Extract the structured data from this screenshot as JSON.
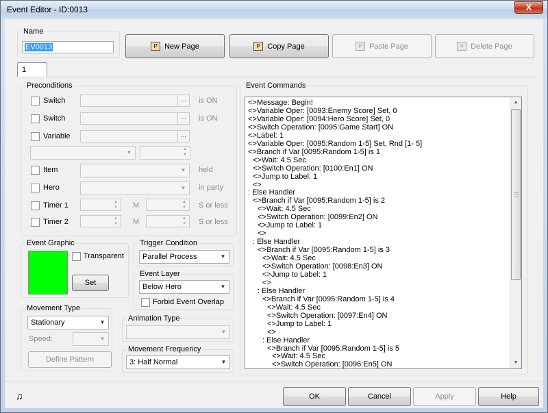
{
  "window": {
    "title": "Event Editor - ID:0013",
    "close_glyph": "X"
  },
  "name_group": {
    "legend": "Name",
    "value": "EV0013"
  },
  "toolbar": {
    "new_page": "New Page",
    "copy_page": "Copy Page",
    "paste_page": "Paste Page",
    "delete_page": "Delete Page"
  },
  "tabs": [
    {
      "label": "1"
    }
  ],
  "preconditions": {
    "legend": "Preconditions",
    "switch1": {
      "label": "Switch",
      "suffix": "is ON"
    },
    "switch2": {
      "label": "Switch",
      "suffix": "is ON"
    },
    "variable": {
      "label": "Variable"
    },
    "item": {
      "label": "Item",
      "suffix": "held"
    },
    "hero": {
      "label": "Hero",
      "suffix": "in party"
    },
    "timer1": {
      "label": "Timer 1",
      "unit": "M",
      "suffix": "S or less"
    },
    "timer2": {
      "label": "Timer 2",
      "unit": "M",
      "suffix": "S or less"
    }
  },
  "event_graphic": {
    "legend": "Event Graphic",
    "transparent_label": "Transparent",
    "set_label": "Set",
    "color": "#00ff00"
  },
  "trigger": {
    "legend": "Trigger Condition",
    "value": "Parallel Process"
  },
  "event_layer": {
    "legend": "Event Layer",
    "value": "Below Hero",
    "forbid_label": "Forbid Event Overlap"
  },
  "movement_type": {
    "legend": "Movement Type",
    "value": "Stationary",
    "speed_label": "Speed:",
    "define_label": "Define Pattern"
  },
  "animation_type": {
    "legend": "Animation Type",
    "value": ""
  },
  "movement_frequency": {
    "legend": "Movement Frequency",
    "value": "3: Half Normal"
  },
  "event_commands": {
    "legend": "Event Commands",
    "lines": [
      {
        "indent": 0,
        "text": "<>Message: Begin!"
      },
      {
        "indent": 0,
        "text": "<>Variable Oper: [0093:Enemy Score] Set, 0"
      },
      {
        "indent": 0,
        "text": "<>Variable Oper: [0094:Hero Score] Set, 0"
      },
      {
        "indent": 0,
        "text": "<>Switch Operation: [0095:Game Start] ON"
      },
      {
        "indent": 0,
        "text": "<>Label: 1"
      },
      {
        "indent": 0,
        "text": "<>Variable Oper: [0095:Random 1-5] Set, Rnd [1- 5]"
      },
      {
        "indent": 0,
        "text": "<>Branch if Var [0095:Random 1-5] is 1"
      },
      {
        "indent": 1,
        "text": "<>Wait: 4.5 Sec"
      },
      {
        "indent": 1,
        "text": "<>Switch Operation: [0100:En1] ON"
      },
      {
        "indent": 1,
        "text": "<>Jump to Label: 1"
      },
      {
        "indent": 1,
        "text": "<>"
      },
      {
        "indent": 0,
        "text": ": Else Handler"
      },
      {
        "indent": 1,
        "text": "<>Branch if Var [0095:Random 1-5] is 2"
      },
      {
        "indent": 2,
        "text": "<>Wait: 4.5 Sec"
      },
      {
        "indent": 2,
        "text": "<>Switch Operation: [0099:En2] ON"
      },
      {
        "indent": 2,
        "text": "<>Jump to Label: 1"
      },
      {
        "indent": 2,
        "text": "<>"
      },
      {
        "indent": 1,
        "text": ": Else Handler"
      },
      {
        "indent": 2,
        "text": "<>Branch if Var [0095:Random 1-5] is 3"
      },
      {
        "indent": 3,
        "text": "<>Wait: 4.5 Sec"
      },
      {
        "indent": 3,
        "text": "<>Switch Operation: [0098:En3] ON"
      },
      {
        "indent": 3,
        "text": "<>Jump to Label: 1"
      },
      {
        "indent": 3,
        "text": "<>"
      },
      {
        "indent": 2,
        "text": ": Else Handler"
      },
      {
        "indent": 3,
        "text": "<>Branch if Var [0095:Random 1-5] is 4"
      },
      {
        "indent": 4,
        "text": "<>Wait: 4.5 Sec"
      },
      {
        "indent": 4,
        "text": "<>Switch Operation: [0097:En4] ON"
      },
      {
        "indent": 4,
        "text": "<>Jump to Label: 1"
      },
      {
        "indent": 4,
        "text": "<>"
      },
      {
        "indent": 3,
        "text": ": Else Handler"
      },
      {
        "indent": 4,
        "text": "<>Branch if Var [0095:Random 1-5] is 5"
      },
      {
        "indent": 5,
        "text": "<>Wait: 4.5 Sec"
      },
      {
        "indent": 5,
        "text": "<>Switch Operation: [0096:En5] ON"
      }
    ]
  },
  "footer": {
    "ok": "OK",
    "cancel": "Cancel",
    "apply": "Apply",
    "help": "Help",
    "music_icon": "music-note-icon"
  }
}
